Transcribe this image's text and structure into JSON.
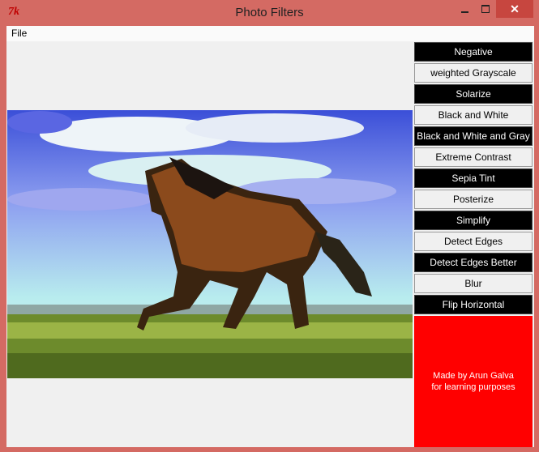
{
  "window": {
    "title": "Photo Filters",
    "icon": "tk-feather-icon",
    "icon_text": "7k",
    "controls": {
      "minimize": "minimize-icon",
      "maximize": "maximize-icon",
      "close": "✕"
    }
  },
  "menu": {
    "file_label": "File"
  },
  "filters": [
    {
      "label": "Negative",
      "style": "dark"
    },
    {
      "label": "weighted Grayscale",
      "style": "light"
    },
    {
      "label": "Solarize",
      "style": "dark"
    },
    {
      "label": "Black and White",
      "style": "light"
    },
    {
      "label": "Black and White and Gray",
      "style": "dark"
    },
    {
      "label": "Extreme Contrast",
      "style": "light"
    },
    {
      "label": "Sepia Tint",
      "style": "dark"
    },
    {
      "label": "Posterize",
      "style": "light"
    },
    {
      "label": "Simplify",
      "style": "dark"
    },
    {
      "label": "Detect Edges",
      "style": "light"
    },
    {
      "label": "Detect Edges Better",
      "style": "dark"
    },
    {
      "label": "Blur",
      "style": "light"
    },
    {
      "label": "Flip Horizontal",
      "style": "dark"
    }
  ],
  "credit": {
    "line1": "Made by Arun Galva",
    "line2": "for learning purposes"
  },
  "colors": {
    "titlebar": "#d46a63",
    "close_button": "#c7463f",
    "credit_panel": "#ff0000",
    "button_dark": "#000000",
    "button_light": "#f0f0f0"
  }
}
